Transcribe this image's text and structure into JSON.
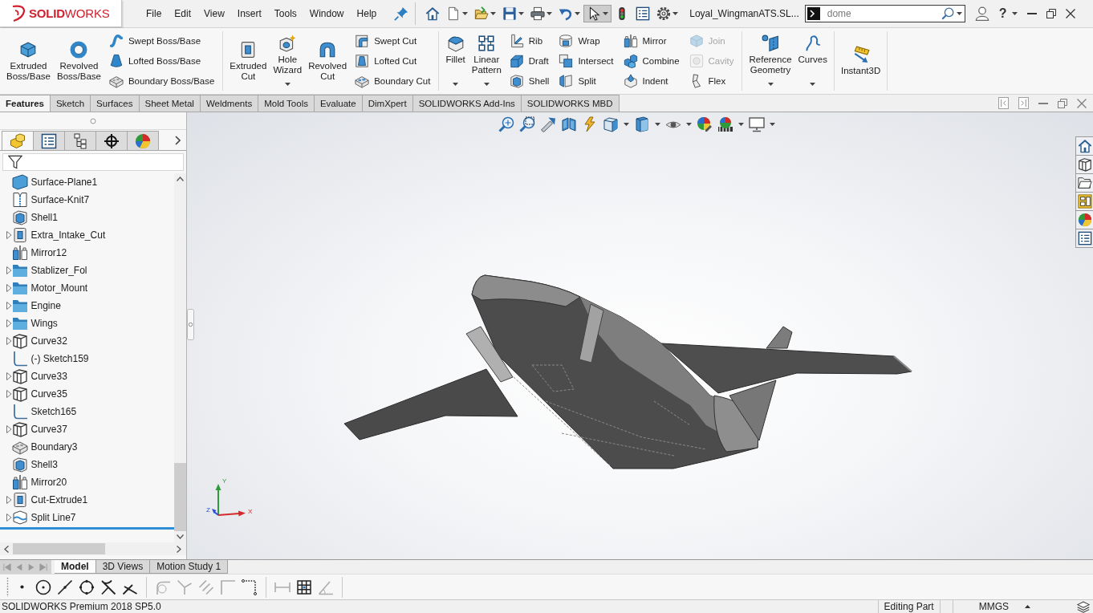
{
  "title_bar": {
    "logo": "**SOLID**WORKS",
    "menu": [
      "File",
      "Edit",
      "View",
      "Insert",
      "Tools",
      "Window",
      "Help"
    ],
    "quick_access": [
      {
        "dropdown": false,
        "selected": false
      },
      {
        "dropdown": true,
        "selected": false
      },
      {
        "dropdown": true,
        "selected": false
      },
      {
        "dropdown": true,
        "selected": false
      },
      {
        "dropdown": true,
        "selected": false
      },
      {
        "dropdown": true,
        "selected": false
      },
      {
        "dropdown": true,
        "selected": true
      },
      {
        "dropdown": false,
        "selected": false
      },
      {
        "dropdown": false,
        "selected": false
      },
      {
        "dropdown": true,
        "selected": false
      }
    ],
    "document_title": "Loyal_WingmanATS.SL...",
    "search": {
      "value": "dome"
    },
    "help": "?"
  },
  "command_manager": {
    "groups": [
      {
        "large_buttons": [
          {
            "label": "Extruded Boss/Base",
            "dropdown": false
          },
          {
            "label": "Revolved Boss/Base",
            "dropdown": false
          }
        ],
        "small_columns": [
          [
            {
              "label": "Swept Boss/Base",
              "disabled": false
            },
            {
              "label": "Lofted Boss/Base",
              "disabled": false
            },
            {
              "label": "Boundary Boss/Base",
              "disabled": false
            }
          ]
        ]
      },
      {
        "large_buttons": [
          {
            "label": "Extruded Cut",
            "dropdown": false
          },
          {
            "label": "Hole Wizard",
            "dropdown": true
          },
          {
            "label": "Revolved Cut",
            "dropdown": false
          }
        ],
        "small_columns": [
          [
            {
              "label": "Swept Cut",
              "disabled": false
            },
            {
              "label": "Lofted Cut",
              "disabled": false
            },
            {
              "label": "Boundary Cut",
              "disabled": false
            }
          ]
        ]
      },
      {
        "large_buttons": [
          {
            "label": "Fillet",
            "dropdown": true
          },
          {
            "label": "Linear Pattern",
            "dropdown": true
          }
        ],
        "small_columns": [
          [
            {
              "label": "Rib",
              "disabled": false
            },
            {
              "label": "Draft",
              "disabled": false
            },
            {
              "label": "Shell",
              "disabled": false
            }
          ],
          [
            {
              "label": "Wrap",
              "disabled": false
            },
            {
              "label": "Intersect",
              "disabled": false
            },
            {
              "label": "Split",
              "disabled": false
            }
          ],
          [
            {
              "label": "Mirror",
              "disabled": false
            },
            {
              "label": "Combine",
              "disabled": false
            },
            {
              "label": "Indent",
              "disabled": false
            }
          ],
          [
            {
              "label": "Join",
              "disabled": true
            },
            {
              "label": "Cavity",
              "disabled": true
            },
            {
              "label": "Flex",
              "disabled": false
            }
          ]
        ]
      },
      {
        "large_buttons": [
          {
            "label": "Reference Geometry",
            "dropdown": true
          },
          {
            "label": "Curves",
            "dropdown": true
          }
        ]
      },
      {
        "large_buttons": [
          {
            "label": "Instant3D",
            "dropdown": false
          }
        ]
      }
    ]
  },
  "command_tabs": [
    {
      "label": "Features",
      "selected": true
    },
    {
      "label": "Sketch",
      "selected": false
    },
    {
      "label": "Surfaces",
      "selected": false
    },
    {
      "label": "Sheet Metal",
      "selected": false
    },
    {
      "label": "Weldments",
      "selected": false
    },
    {
      "label": "Mold Tools",
      "selected": false
    },
    {
      "label": "Evaluate",
      "selected": false
    },
    {
      "label": "DimXpert",
      "selected": false
    },
    {
      "label": "SOLIDWORKS Add-Ins",
      "selected": false
    },
    {
      "label": "SOLIDWORKS MBD",
      "selected": false
    }
  ],
  "feature_manager": {
    "panel_tabs": [
      {
        "selected": true
      },
      {
        "selected": false
      },
      {
        "selected": false
      },
      {
        "selected": false
      },
      {
        "selected": false
      }
    ],
    "tree": [
      {
        "label": "Surface-Plane1",
        "expandable": false
      },
      {
        "label": "Surface-Knit7",
        "expandable": false
      },
      {
        "label": "Shell1",
        "expandable": false
      },
      {
        "label": "Extra_Intake_Cut",
        "expandable": true
      },
      {
        "label": "Mirror12",
        "expandable": false
      },
      {
        "label": "Stablizer_Fol",
        "expandable": true
      },
      {
        "label": "Motor_Mount",
        "expandable": true
      },
      {
        "label": "Engine",
        "expandable": true
      },
      {
        "label": "Wings",
        "expandable": true
      },
      {
        "label": "Curve32",
        "expandable": true
      },
      {
        "label": "(-) Sketch159",
        "expandable": false
      },
      {
        "label": "Curve33",
        "expandable": true
      },
      {
        "label": "Curve35",
        "expandable": true
      },
      {
        "label": "Sketch165",
        "expandable": false
      },
      {
        "label": "Curve37",
        "expandable": true
      },
      {
        "label": "Boundary3",
        "expandable": false
      },
      {
        "label": "Shell3",
        "expandable": false
      },
      {
        "label": "Mirror20",
        "expandable": false
      },
      {
        "label": "Cut-Extrude1",
        "expandable": true
      },
      {
        "label": "Split Line7",
        "expandable": true
      }
    ]
  },
  "triad": {
    "x": "X",
    "y": "Y",
    "z": "Z"
  },
  "bottom_tabs": [
    {
      "label": "Model",
      "selected": true
    },
    {
      "label": "3D Views",
      "selected": false
    },
    {
      "label": "Motion Study 1",
      "selected": false
    }
  ],
  "sketch_toolbar": [
    {
      "disabled": false
    },
    {
      "disabled": false
    },
    {
      "disabled": false
    },
    {
      "disabled": false
    },
    {
      "disabled": false
    },
    {
      "disabled": false
    },
    {
      "disabled": true
    },
    {
      "disabled": true
    },
    {
      "disabled": true
    },
    {
      "disabled": true
    },
    {
      "disabled": false
    },
    {
      "disabled": true
    },
    {
      "disabled": false
    },
    {
      "disabled": true
    }
  ],
  "status_bar": {
    "product": "SOLIDWORKS Premium 2018 SP5.0",
    "mode": "Editing Part",
    "units": "MMGS"
  }
}
